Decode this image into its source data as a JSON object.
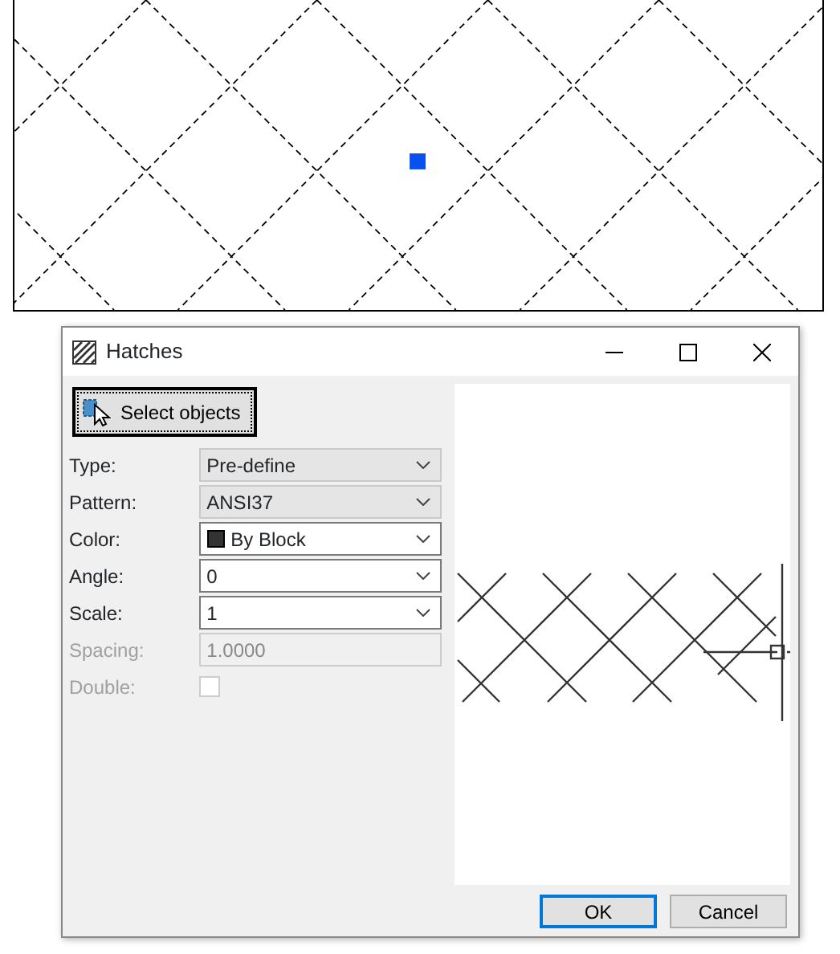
{
  "dialog": {
    "title": "Hatches",
    "select_button": "Select objects",
    "fields": [
      {
        "label": "Type:",
        "kind": "list",
        "value": "Pre-define",
        "disabled": false
      },
      {
        "label": "Pattern:",
        "kind": "list",
        "value": "ANSI37",
        "disabled": false
      },
      {
        "label": "Color:",
        "kind": "color",
        "value": "By Block",
        "disabled": false
      },
      {
        "label": "Angle:",
        "kind": "combo",
        "value": "0",
        "disabled": false
      },
      {
        "label": "Scale:",
        "kind": "combo",
        "value": "1",
        "disabled": false
      },
      {
        "label": "Spacing:",
        "kind": "text",
        "value": "1.0000",
        "disabled": true
      },
      {
        "label": "Double:",
        "kind": "checkbox",
        "checked": false,
        "disabled": true
      }
    ],
    "buttons": [
      {
        "label": "OK",
        "selected": true
      },
      {
        "label": "Cancel",
        "selected": false
      }
    ]
  }
}
